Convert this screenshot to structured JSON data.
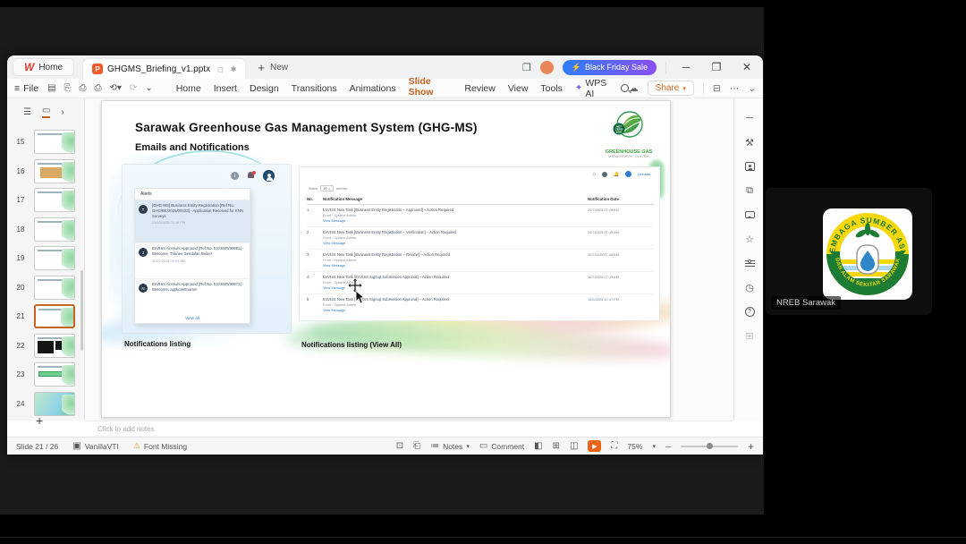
{
  "colors": {
    "accent": "#c75e1e",
    "promo_gradient_start": "#2e7cf6",
    "promo_gradient_end": "#8a4ff0",
    "link_blue": "#2f7bd0",
    "play_orange": "#e8641a",
    "warning": "#e0a02f"
  },
  "meeting": {
    "participant_label": "NREB Sarawak",
    "logo_top_arc": "LEMBAGA SUMBER ASLI",
    "logo_bottom_arc": "DAN ALAM SEKITAR SARAWAK"
  },
  "titlebar": {
    "home_tab": "Home",
    "doc_tab": "GHGMS_Briefing_v1.pptx",
    "unsaved_mark": "✱",
    "new_label": "New",
    "promo_label": "Black Friday Sale"
  },
  "menubar": {
    "file_label": "File",
    "items": [
      "Home",
      "Insert",
      "Design",
      "Transitions",
      "Animations",
      "Slide Show",
      "Review",
      "View",
      "Tools"
    ],
    "active_item": "Slide Show",
    "wps_ai_label": "WPS AI",
    "share_label": "Share"
  },
  "thumbnails": {
    "numbers": [
      "15",
      "16",
      "17",
      "18",
      "19",
      "20",
      "21",
      "22",
      "23",
      "24"
    ],
    "selected": "21"
  },
  "slide": {
    "title": "Sarawak Greenhouse Gas Management System (GHG-MS)",
    "subtitle": "Emails and Notifications",
    "logo": {
      "badge": "NET ZERO 2050",
      "line1": "GREENHOUSE GAS",
      "line2": "MANAGEMENT SYSTEM"
    },
    "caption_left": "Notifications listing",
    "caption_right": "Notifications listing (View All)",
    "alerts": {
      "header": "Alerts",
      "view_all": "View all",
      "items": [
        {
          "initial": "T",
          "text": "[GHG-MS] Business Entity Registration [Ref No. GHG/BE/2025/00023] - Application Received for KNN Surveys",
          "time": "21/10/2025 02:19 PM"
        },
        {
          "initial": "J",
          "text": "EnVISS Account Approved [Ref No. ES/2025/00081] - Welcome, Trainee Sembilan Belas!",
          "time": "30/07/2025 09:09 AM"
        },
        {
          "initial": "N",
          "text": "EnVISS Account Approved [Ref No. ES/2025/00072] - Welcome, applicanttname!",
          "time": ""
        }
      ]
    },
    "portal": {
      "user_name": "johnssa",
      "show_label": "Show",
      "page_size": "10",
      "entries_label": "entries",
      "columns": [
        "No.",
        "Notification Message",
        "Notification Date"
      ],
      "rows": [
        {
          "no": "1",
          "message": "EnVISS New Task [Business Entity Registration – Approved] – Action Required",
          "from": "From : System Admin",
          "link": "View Message",
          "date": "30/7/2025 07:49 AM"
        },
        {
          "no": "2",
          "message": "EnVISS New Task [Business Entity Registration – Verification] – Action Required",
          "from": "From : System Admin",
          "link": "View Message",
          "date": "30/7/2025 07:49 AM"
        },
        {
          "no": "3",
          "message": "EnVISS New Task [Business Entity Registration – Review] – Action Required",
          "from": "From : System Admin",
          "link": "View Message",
          "date": "30/7/2025 07:46 AM"
        },
        {
          "no": "4",
          "message": "EnVISS New Task [EnVISS Signup Submission Approval] – Action Required",
          "from": "From : System Admin",
          "link": "View Message",
          "date": "30/7/2025 07:39 AM"
        },
        {
          "no": "5",
          "message": "EnVISS New Task [EnVISS Signup Submission Approval] – Action Required",
          "from": "From : System Admin",
          "link": "View Message",
          "date": "16/6/2025 12:47 PM"
        }
      ]
    }
  },
  "notes": {
    "placeholder": "Click to add notes"
  },
  "statusbar": {
    "slide_counter": "Slide 21 / 26",
    "theme_name": "VanillaVTI",
    "font_missing": "Font Missing",
    "notes_label": "Notes",
    "comment_label": "Comment",
    "zoom_level": "75%"
  }
}
